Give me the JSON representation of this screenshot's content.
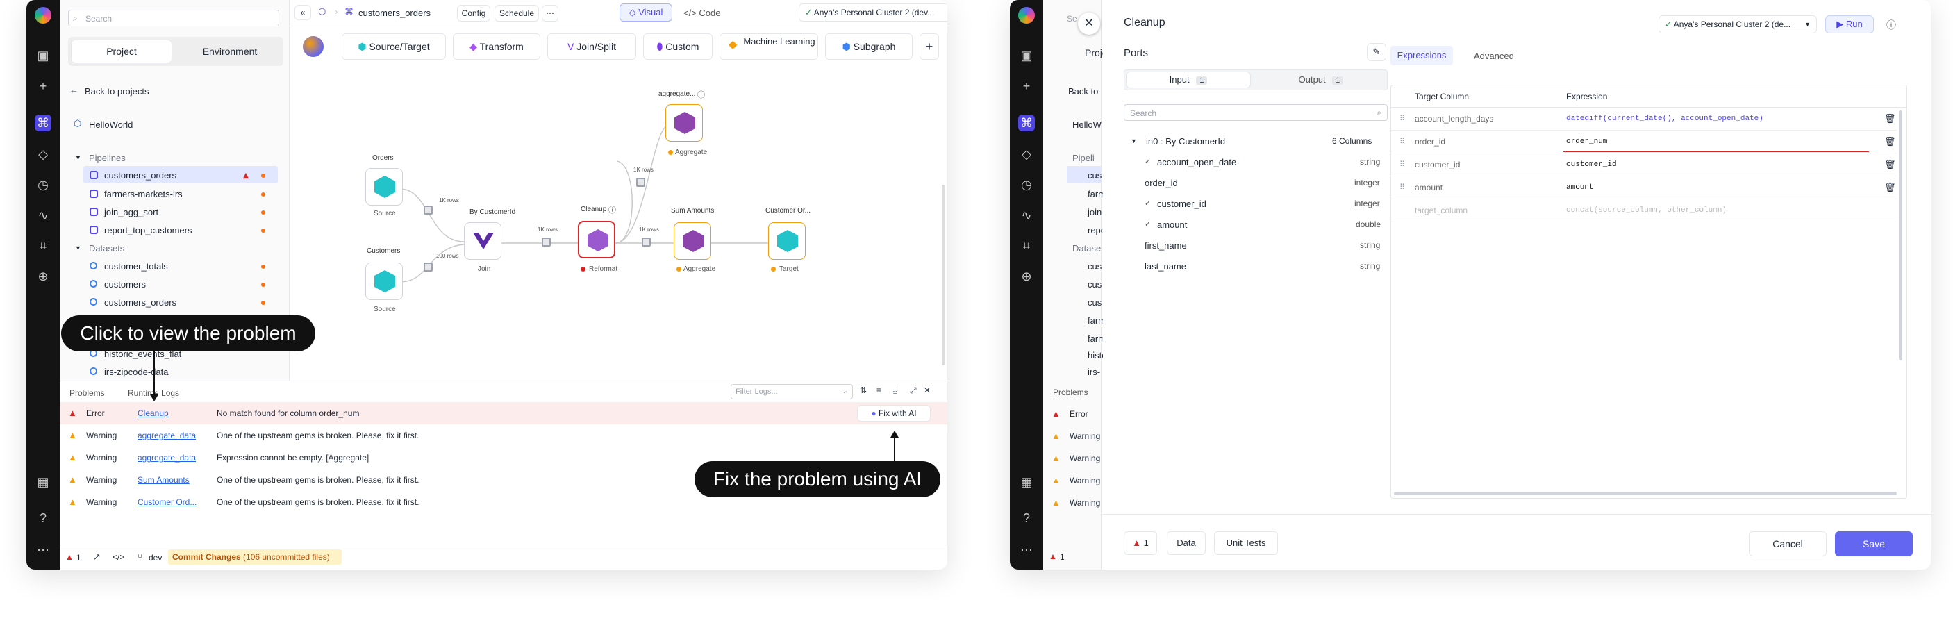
{
  "left": {
    "search_placeholder": "Search",
    "tabs": [
      "Project",
      "Environment"
    ],
    "back": "Back to projects",
    "project": "HelloWorld",
    "pipelines_header": "Pipelines",
    "pipelines": [
      "customers_orders",
      "farmers-markets-irs",
      "join_agg_sort",
      "report_top_customers"
    ],
    "datasets_header": "Datasets",
    "datasets": [
      "customer_totals",
      "customers",
      "customers_orders",
      "historic_events_flat",
      "irs-zipcode-data"
    ],
    "topbar": {
      "pipeline": "customers_orders",
      "config": "Config",
      "schedule": "Schedule",
      "more": "⋯",
      "visual": "Visual",
      "code": "Code",
      "cluster": "Anya's Personal Cluster 2 (dev..."
    },
    "gem_bar": [
      "Source/Target",
      "Transform",
      "Join/Split",
      "Custom",
      "Machine Learning",
      "Subgraph"
    ],
    "nodes": {
      "orders": "Orders",
      "source": "Source",
      "customers": "Customers",
      "source2": "Source",
      "by_customer": "By CustomerId",
      "join": "Join",
      "cleanup": "Cleanup",
      "reformat": "Reformat",
      "sum_amounts": "Sum Amounts",
      "aggregate": "Aggregate",
      "customer_ord": "Customer Or...",
      "target": "Target",
      "aggregate_top": "aggregate...",
      "aggregate_top_label": "Aggregate",
      "rows_1k": "1K rows",
      "rows_100": "100 rows"
    },
    "problems": {
      "tab1": "Problems",
      "tab2": "Runtime Logs",
      "filter_placeholder": "Filter Logs...",
      "fix_ai": "Fix with AI",
      "rows": [
        {
          "level": "Error",
          "gem": "Cleanup",
          "msg": "No match found for column order_num"
        },
        {
          "level": "Warning",
          "gem": "aggregate_data",
          "msg": "One of the upstream gems is broken. Please, fix it first."
        },
        {
          "level": "Warning",
          "gem": "aggregate_data",
          "msg": "Expression cannot be empty. [Aggregate]"
        },
        {
          "level": "Warning",
          "gem": "Sum Amounts",
          "msg": "One of the upstream gems is broken. Please, fix it first."
        },
        {
          "level": "Warning",
          "gem": "Customer Ord...",
          "msg": "One of the upstream gems is broken. Please, fix it first."
        }
      ]
    },
    "status": {
      "errors": "1",
      "branch": "dev",
      "commit": "Commit Changes",
      "uncommitted": "(106 uncommitted files)"
    },
    "callout1": "Click to view the problem",
    "callout2": "Fix the problem using AI"
  },
  "right": {
    "title": "Cleanup",
    "cluster": "Anya's Personal Cluster 2 (de...",
    "run": "Run",
    "ports": "Ports",
    "input_tab": "Input",
    "input_count": "1",
    "output_tab": "Output",
    "output_count": "1",
    "search_placeholder": "Search",
    "port_name": "in0 : By CustomerId",
    "columns_count": "6 Columns",
    "columns": [
      {
        "name": "account_open_date",
        "type": "string",
        "checked": true
      },
      {
        "name": "order_id",
        "type": "integer",
        "checked": false
      },
      {
        "name": "customer_id",
        "type": "integer",
        "checked": true
      },
      {
        "name": "amount",
        "type": "double",
        "checked": true
      },
      {
        "name": "first_name",
        "type": "string",
        "checked": false
      },
      {
        "name": "last_name",
        "type": "string",
        "checked": false
      }
    ],
    "tab_expr": "Expressions",
    "tab_adv": "Advanced",
    "col_target": "Target Column",
    "col_expr": "Expression",
    "rows": [
      {
        "target": "account_length_days",
        "expr": "datediff(current_date(), account_open_date)"
      },
      {
        "target": "order_id",
        "expr": "order_num"
      },
      {
        "target": "customer_id",
        "expr": "customer_id"
      },
      {
        "target": "amount",
        "expr": "amount"
      }
    ],
    "placeholder_target": "target_column",
    "placeholder_expr": "concat(source_column, other_column)",
    "footer": {
      "errors": "1",
      "data": "Data",
      "unit_tests": "Unit Tests",
      "cancel": "Cancel",
      "save": "Save"
    },
    "bg": {
      "search": "Se",
      "proj": "Proje",
      "back": "Back to",
      "hello": "HelloW",
      "pipel": "Pipeli",
      "items": [
        "cus",
        "farm",
        "join",
        "repo"
      ],
      "datasets": "Datase",
      "ds": [
        "cus",
        "cus",
        "cus",
        "farm",
        "farm",
        "histo",
        "irs-"
      ],
      "problems": "Problems",
      "levels": [
        "Error",
        "Warning",
        "Warning",
        "Warning",
        "Warning"
      ],
      "errs": "1"
    }
  },
  "colors": {
    "accent": "#4f46e5",
    "error": "#dc2626",
    "warning": "#f59e0b",
    "gem_purple": "#7e3fb8",
    "gem_teal": "#22c3c9"
  }
}
